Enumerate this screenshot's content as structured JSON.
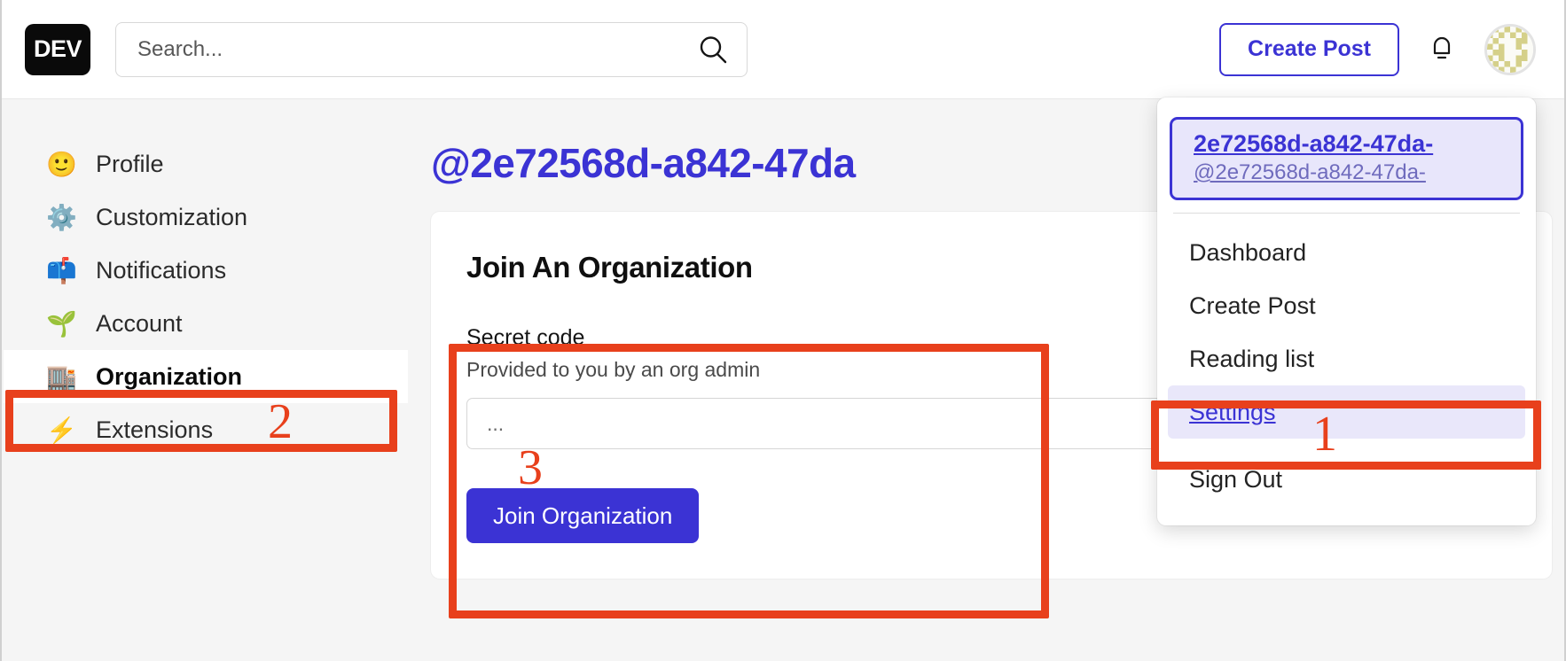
{
  "header": {
    "logo_text": "DEV",
    "search": {
      "value": "",
      "placeholder": "Search..."
    },
    "search_icon": "search-icon",
    "create_post_label": "Create Post",
    "bell_icon": "bell-icon",
    "avatar_label": "user-avatar"
  },
  "sidebar": {
    "items": [
      {
        "label": "Profile",
        "emoji": "🙂",
        "icon": "smiley-face-icon",
        "active": false
      },
      {
        "label": "Customization",
        "emoji": "⚙️",
        "icon": "gear-icon",
        "active": false
      },
      {
        "label": "Notifications",
        "emoji": "📫",
        "icon": "mailbox-icon",
        "active": false
      },
      {
        "label": "Account",
        "emoji": "🌱",
        "icon": "seedling-icon",
        "active": false
      },
      {
        "label": "Organization",
        "emoji": "🏬",
        "icon": "department-store-icon",
        "active": true
      },
      {
        "label": "Extensions",
        "emoji": "⚡",
        "icon": "lightning-bolt-icon",
        "active": false
      }
    ]
  },
  "main": {
    "page_title": "@2e72568d-a842-47da",
    "card": {
      "title": "Join An Organization",
      "field_label": "Secret code",
      "field_hint": "Provided to you by an org admin",
      "input_value": "",
      "input_placeholder": "...",
      "submit_label": "Join Organization"
    }
  },
  "dropdown": {
    "user_name": "2e72568d-a842-47da-",
    "user_handle": "@2e72568d-a842-47da-",
    "items": [
      {
        "label": "Dashboard",
        "highlight": false
      },
      {
        "label": "Create Post",
        "highlight": false
      },
      {
        "label": "Reading list",
        "highlight": false
      },
      {
        "label": "Settings",
        "highlight": true
      },
      {
        "label": "Sign Out",
        "highlight": false
      }
    ]
  },
  "annotations": {
    "step_1": "1",
    "step_2": "2",
    "step_3": "3",
    "color": "#e8401c"
  },
  "colors": {
    "brand_indigo": "#3b33d4",
    "page_bg": "#f5f5f5",
    "card_bg": "#ffffff",
    "annotation_red": "#e8401c",
    "highlight_lavender": "#e9e7fa"
  }
}
